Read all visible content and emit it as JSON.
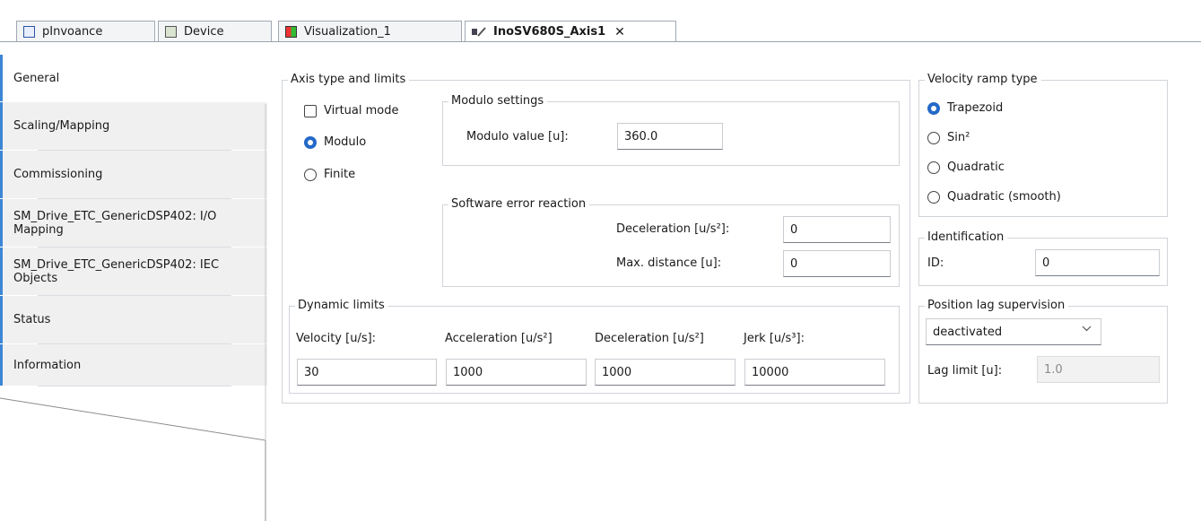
{
  "tabs": [
    {
      "label": "pInvoance",
      "icon": "pou-icon"
    },
    {
      "label": "Device",
      "icon": "device-icon"
    },
    {
      "label": "Visualization_1",
      "icon": "visualization-icon"
    },
    {
      "label": "InoSV680S_Axis1",
      "icon": "axis-icon",
      "active": true,
      "close": "✕"
    }
  ],
  "nav": {
    "items": [
      {
        "label": "General"
      },
      {
        "label": "Scaling/Mapping"
      },
      {
        "label": "Commissioning"
      },
      {
        "label": "SM_Drive_ETC_GenericDSP402: I/O Mapping"
      },
      {
        "label": "SM_Drive_ETC_GenericDSP402: IEC Objects"
      },
      {
        "label": "Status"
      },
      {
        "label": "Information"
      }
    ]
  },
  "axis_type": {
    "title": "Axis type and limits",
    "virtual_mode": "Virtual mode",
    "modulo": "Modulo",
    "finite": "Finite",
    "modulo_settings": {
      "title": "Modulo settings",
      "label": "Modulo value [u]:",
      "value": "360.0"
    },
    "software_error": {
      "title": "Software error reaction",
      "decel_label": "Deceleration [u/s²]:",
      "decel_value": "0",
      "maxdist_label": "Max. distance [u]:",
      "maxdist_value": "0"
    }
  },
  "dynamic_limits": {
    "title": "Dynamic limits",
    "velocity_label": "Velocity [u/s]:",
    "velocity_value": "30",
    "accel_label": "Acceleration [u/s²]",
    "accel_value": "1000",
    "decel_label": "Deceleration [u/s²]",
    "decel_value": "1000",
    "jerk_label": "Jerk [u/s³]:",
    "jerk_value": "10000"
  },
  "velocity_ramp": {
    "title": "Velocity ramp type",
    "options": [
      "Trapezoid",
      "Sin²",
      "Quadratic",
      "Quadratic (smooth)"
    ],
    "selected": "Trapezoid"
  },
  "identification": {
    "title": "Identification",
    "id_label": "ID:",
    "id_value": "0"
  },
  "position_lag": {
    "title": "Position lag supervision",
    "mode": "deactivated",
    "lag_label": "Lag limit [u]:",
    "lag_value": "1.0"
  },
  "colors": {
    "accent": "#3d86d6",
    "radio_on": "#2469c8"
  }
}
